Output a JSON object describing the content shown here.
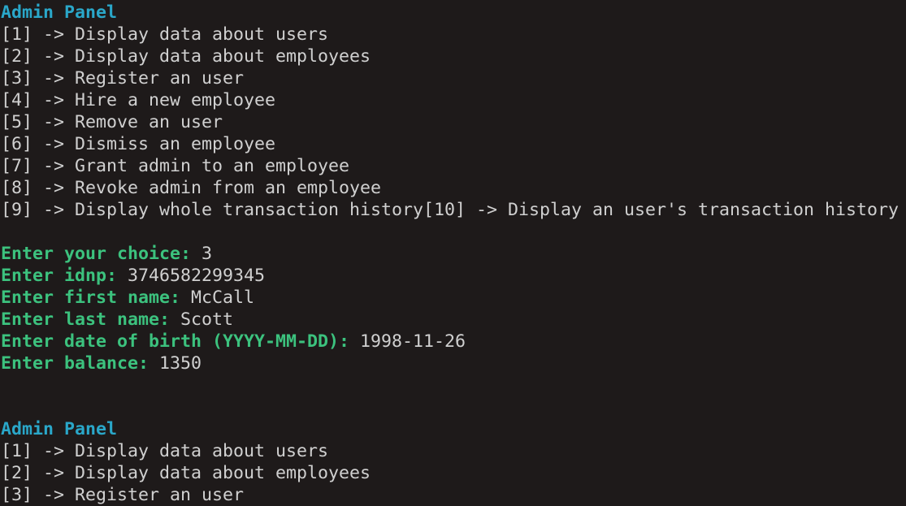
{
  "block1": {
    "title": "Admin Panel",
    "menu": [
      "[1] -> Display data about users",
      "[2] -> Display data about employees",
      "[3] -> Register an user",
      "[4] -> Hire a new employee",
      "[5] -> Remove an user",
      "[6] -> Dismiss an employee",
      "[7] -> Grant admin to an employee",
      "[8] -> Revoke admin from an employee",
      "[9] -> Display whole transaction history[10] -> Display an user's transaction history"
    ]
  },
  "form": [
    {
      "label": "Enter your choice:",
      "value": "3"
    },
    {
      "label": "Enter idnp:",
      "value": "3746582299345"
    },
    {
      "label": "Enter first name:",
      "value": "McCall"
    },
    {
      "label": "Enter last name:",
      "value": "Scott"
    },
    {
      "label": "Enter date of birth (YYYY-MM-DD):",
      "value": "1998-11-26"
    },
    {
      "label": "Enter balance:",
      "value": "1350"
    }
  ],
  "block2": {
    "title": "Admin Panel",
    "menu": [
      "[1] -> Display data about users",
      "[2] -> Display data about employees",
      "[3] -> Register an user"
    ]
  }
}
